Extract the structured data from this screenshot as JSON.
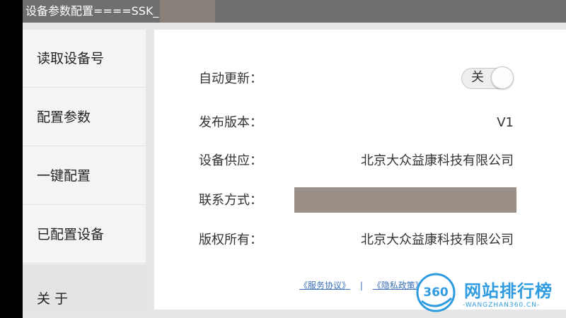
{
  "window": {
    "title": "设备参数配置====SSK_"
  },
  "sidebar": {
    "items": [
      {
        "label": "读取设备号"
      },
      {
        "label": "配置参数"
      },
      {
        "label": "一键配置"
      },
      {
        "label": "已配置设备"
      },
      {
        "label": "关 于"
      }
    ],
    "active_index": 4
  },
  "about": {
    "auto_update": {
      "label": "自动更新：",
      "toggle_text": "关",
      "on": false
    },
    "version": {
      "label": "发布版本：",
      "value": "V1"
    },
    "supplier": {
      "label": "设备供应：",
      "value": "北京大众益康科技有限公司"
    },
    "contact": {
      "label": "联系方式："
    },
    "copyright": {
      "label": "版权所有：",
      "value": "北京大众益康科技有限公司"
    }
  },
  "footer": {
    "service_agreement": "《服务协议》",
    "separator": "|",
    "privacy_policy": "《隐私政策》"
  },
  "watermark": {
    "badge": "360",
    "title": "网站排行榜",
    "subtitle": "-WANGZHAN360.CN-"
  },
  "colors": {
    "titlebar": "#6f6f6f",
    "link": "#3a6fb8",
    "watermark": "#2f9be0"
  }
}
